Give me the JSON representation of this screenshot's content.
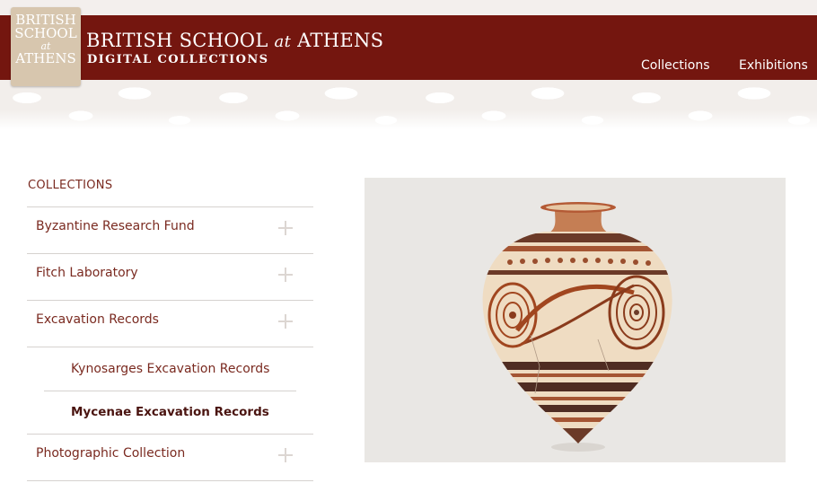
{
  "logo": {
    "line1": "BRITISH",
    "line2": "SCHOOL",
    "line3": "at",
    "line4": "ATHENS"
  },
  "header": {
    "title_pre": "BRITISH SCHOOL",
    "title_at": "at",
    "title_post": "ATHENS",
    "subtitle": "DIGITAL COLLECTIONS",
    "nav": {
      "collections": "Collections",
      "exhibitions": "Exhibitions"
    }
  },
  "sidebar": {
    "heading": "COLLECTIONS",
    "items": [
      {
        "label": "Byzantine Research Fund",
        "expand_icon": "plus-icon"
      },
      {
        "label": "Fitch Laboratory",
        "expand_icon": "plus-icon"
      },
      {
        "label": "Excavation Records",
        "expand_icon": "plus-icon",
        "expanded": true
      },
      {
        "label": "Photographic Collection",
        "expand_icon": "plus-icon"
      }
    ],
    "subitems": [
      {
        "label": "Kynosarges Excavation Records",
        "active": false
      },
      {
        "label": "Mycenae Excavation Records",
        "active": true
      }
    ]
  },
  "colors": {
    "header_bg": "#74160f",
    "link": "#7a2a20",
    "logo_bg": "#d7c6ae",
    "art_bg": "#e9e7e4"
  }
}
